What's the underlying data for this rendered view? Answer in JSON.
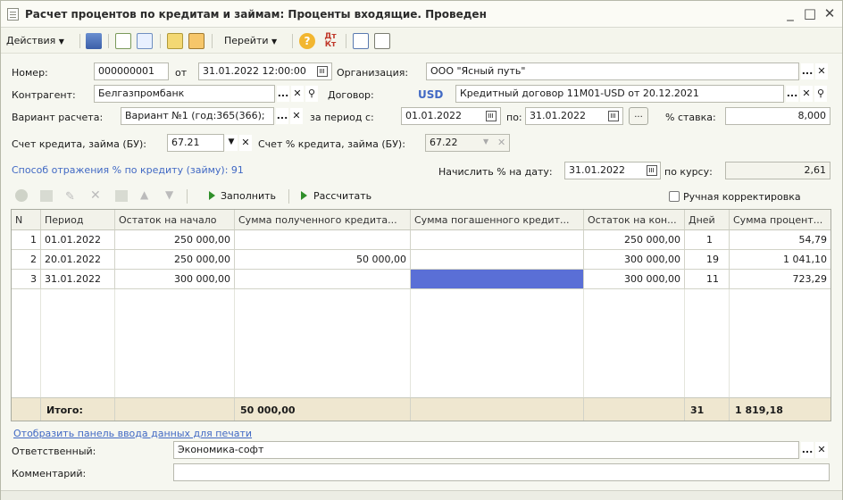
{
  "window": {
    "title": "Расчет процентов по кредитам и займам: Проценты входящие. Проведен",
    "minimize": "_",
    "maximize": "□",
    "close": "✕"
  },
  "toolbar": {
    "actions_label": "Действия",
    "goto_label": "Перейти"
  },
  "form": {
    "number_label": "Номер:",
    "number_value": "000000001",
    "from_label": "от",
    "date_value": "31.01.2022 12:00:00",
    "org_label": "Организация:",
    "org_value": "ООО \"Ясный путь\"",
    "counterparty_label": "Контрагент:",
    "counterparty_value": "Белгазпромбанк",
    "contract_label": "Договор:",
    "currency": "USD",
    "contract_value": "Кредитный договор 11М01-USD от 20.12.2021",
    "calc_variant_label": "Вариант расчета:",
    "calc_variant_value": "Вариант №1 (год:365(366);",
    "period_from_label": "за период с:",
    "period_from_value": "01.01.2022",
    "period_to_label": "по:",
    "period_to_value": "31.01.2022",
    "period_btn": "...",
    "rate_label": "% ставка:",
    "rate_value": "8,000",
    "credit_account_label": "Счет кредита, займа (БУ):",
    "credit_account_value": "67.21",
    "interest_account_label": "Счет % кредита, займа (БУ):",
    "interest_account_value": "67.22",
    "method_link": "Способ отражения % по кредиту (займу): 91",
    "accrue_date_label": "Начислить % на дату:",
    "accrue_date_value": "31.01.2022",
    "exchange_rate_label": "по курсу:",
    "exchange_rate_value": "2,61"
  },
  "grid_toolbar": {
    "fill_label": "Заполнить",
    "calculate_label": "Рассчитать",
    "manual_label": "Ручная корректировка"
  },
  "table": {
    "headers": [
      "N",
      "Период",
      "Остаток на начало",
      "Сумма полученного кредита...",
      "Сумма погашенного кредит...",
      "Остаток на кон...",
      "Дней",
      "Сумма процент..."
    ],
    "rows": [
      [
        "1",
        "01.01.2022",
        "250 000,00",
        "",
        "",
        "250 000,00",
        "1",
        "54,79"
      ],
      [
        "2",
        "20.01.2022",
        "250 000,00",
        "50 000,00",
        "",
        "300 000,00",
        "19",
        "1 041,10"
      ],
      [
        "3",
        "31.01.2022",
        "300 000,00",
        "",
        "",
        "300 000,00",
        "11",
        "723,29"
      ]
    ],
    "footer": {
      "label": "Итого:",
      "received_total": "50 000,00",
      "days_total": "31",
      "interest_total": "1 819,18"
    }
  },
  "bottom": {
    "print_panel_link": "Отобразить панель ввода данных для печати",
    "responsible_label": "Ответственный:",
    "responsible_value": "Экономика-софт",
    "comment_label": "Комментарий:",
    "comment_value": ""
  },
  "colors": {
    "accent_blue": "#4169c4",
    "selected_cell": "#5a6fd6",
    "footer_bg": "#efe7d0",
    "play_green": "#2f8f2a"
  }
}
